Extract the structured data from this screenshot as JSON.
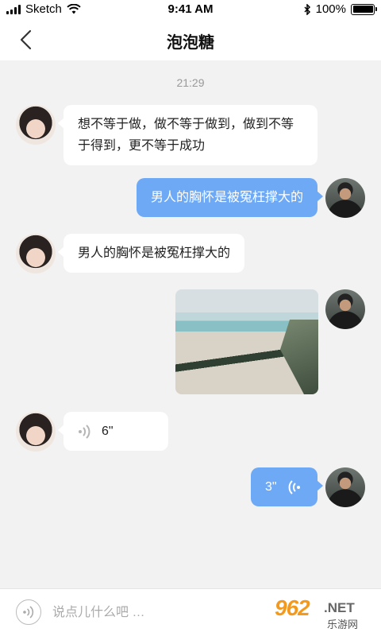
{
  "status_bar": {
    "carrier": "Sketch",
    "time": "9:41 AM",
    "battery": "100%",
    "icons": [
      "signal-icon",
      "wifi-icon",
      "bluetooth-icon",
      "battery-icon"
    ]
  },
  "nav": {
    "back_icon": "chevron-left-icon",
    "title": "泡泡糖"
  },
  "chat": {
    "timestamp": "21:29",
    "messages": [
      {
        "side": "received",
        "type": "text",
        "text": "想不等于做，做不等于做到，做到不等于得到，更不等于成功"
      },
      {
        "side": "sent",
        "type": "text",
        "text": "男人的胸怀是被冤枉撑大的"
      },
      {
        "side": "received",
        "type": "text",
        "text": "男人的胸怀是被冤枉撑大的"
      },
      {
        "side": "sent",
        "type": "image",
        "image": "beach-photo"
      },
      {
        "side": "received",
        "type": "voice",
        "duration": "6\""
      },
      {
        "side": "sent",
        "type": "voice",
        "duration": "3\""
      }
    ]
  },
  "input_bar": {
    "voice_icon": "voice-icon",
    "placeholder": "说点儿什么吧 …"
  },
  "watermark": {
    "number": "962",
    "suffix": ".NET",
    "subtitle": "乐游网"
  },
  "colors": {
    "sent_bubble": "#6ea9f5",
    "received_bubble": "#ffffff",
    "background": "#f2f2f2"
  }
}
